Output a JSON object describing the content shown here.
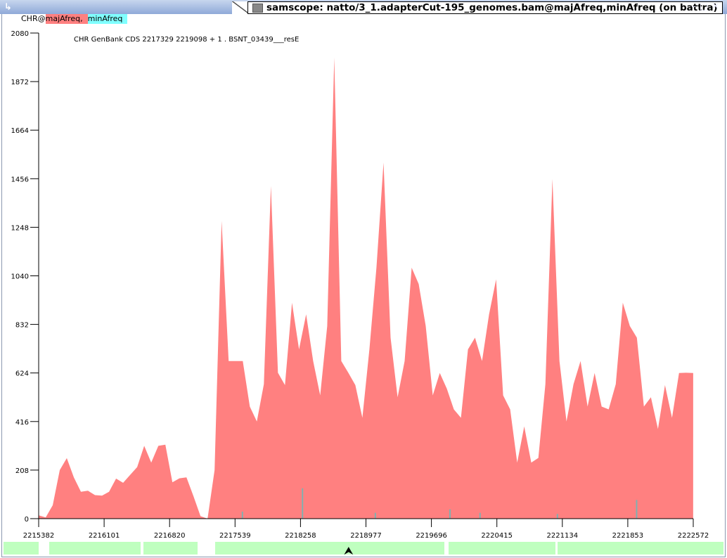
{
  "window": {
    "title": "samscope: natto/3_1.adapterCut-195_genomes.bam@majAfreq,minAfreq (on battra)"
  },
  "legend": {
    "prefix": "CHR@",
    "items": [
      {
        "label": "majAfreq,",
        "color": "#ff8080"
      },
      {
        "label": "minAfreq",
        "color": "#80ffff"
      }
    ]
  },
  "annotation": "CHR GenBank CDS 2217329 2219098 + 1 . BSNT_03439___resE",
  "chart_data": {
    "type": "area",
    "title": "",
    "xlabel": "",
    "ylabel": "",
    "xlim": [
      2215382,
      2222572
    ],
    "ylim": [
      0,
      2080
    ],
    "xticks": [
      2215382,
      2216101,
      2216820,
      2217539,
      2218258,
      2218977,
      2219696,
      2220415,
      2221134,
      2221853,
      2222572
    ],
    "yticks": [
      0,
      208,
      416,
      624,
      832,
      1040,
      1248,
      1456,
      1664,
      1872,
      2080
    ],
    "series": [
      {
        "name": "majAfreq",
        "color": "#ff8080",
        "x_start": 2215382,
        "x_step": 77.3,
        "values": [
          15,
          5,
          60,
          200,
          270,
          170,
          120,
          115,
          105,
          95,
          120,
          165,
          160,
          180,
          230,
          300,
          250,
          300,
          330,
          150,
          180,
          170,
          100,
          10,
          0,
          200,
          1300,
          650,
          700,
          650,
          500,
          400,
          600,
          1400,
          650,
          550,
          950,
          700,
          900,
          650,
          550,
          800,
          2000,
          650,
          650,
          550,
          450,
          700,
          1100,
          1500,
          800,
          500,
          700,
          1050,
          1030,
          800,
          550,
          600,
          580,
          450,
          450,
          700,
          800,
          650,
          900,
          1000,
          550,
          450,
          250,
          380,
          250,
          250,
          600,
          1430,
          700,
          400,
          600,
          650,
          500,
          600,
          500,
          450,
          600,
          900,
          850,
          750,
          500,
          500,
          400,
          550,
          450,
          600,
          650,
          600
        ]
      },
      {
        "name": "minAfreq",
        "color": "#80b0b0",
        "points": [
          [
            2217620,
            30
          ],
          [
            2218280,
            130
          ],
          [
            2219080,
            25
          ],
          [
            2219900,
            40
          ],
          [
            2220230,
            25
          ],
          [
            2221080,
            20
          ],
          [
            2221950,
            80
          ]
        ]
      }
    ],
    "grid": false
  }
}
